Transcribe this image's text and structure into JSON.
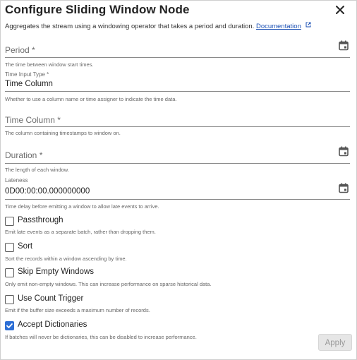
{
  "dialog": {
    "title": "Configure Sliding Window Node",
    "subtitle": "Aggregates the stream using a windowing operator that takes a period and duration.",
    "doc_link": "Documentation"
  },
  "fields": {
    "period": {
      "placeholder": "Period *",
      "hint": "The time between window start times."
    },
    "time_input_type": {
      "label": "Time Input Type *",
      "value": "Time Column",
      "hint": "Whether to use a column name or time assigner to indicate the time data."
    },
    "time_column": {
      "placeholder": "Time Column *",
      "hint": "The column containing timestamps to window on."
    },
    "duration": {
      "placeholder": "Duration *",
      "hint": "The length of each window."
    },
    "lateness": {
      "label": "Lateness",
      "value": "0D00:00:00.000000000",
      "hint": "Time delay before emitting a window to allow late events to arrive."
    }
  },
  "checkboxes": [
    {
      "label": "Passthrough",
      "checked": false,
      "hint": "Emit late events as a separate batch, rather than dropping them."
    },
    {
      "label": "Sort",
      "checked": false,
      "hint": "Sort the records within a window ascending by time."
    },
    {
      "label": "Skip Empty Windows",
      "checked": false,
      "hint": "Only emit non-empty windows. This can increase performance on sparse historical data."
    },
    {
      "label": "Use Count Trigger",
      "checked": false,
      "hint": "Emit if the buffer size exceeds a maximum number of records."
    },
    {
      "label": "Accept Dictionaries",
      "checked": true,
      "hint": "If batches will never be dictionaries, this can be disabled to increase performance."
    }
  ],
  "actions": {
    "apply_label": "Apply",
    "apply_disabled": true
  },
  "colors": {
    "accent": "#2d6fd6",
    "link": "#1a4fb4",
    "disabled_bg": "#e6e6e6"
  }
}
